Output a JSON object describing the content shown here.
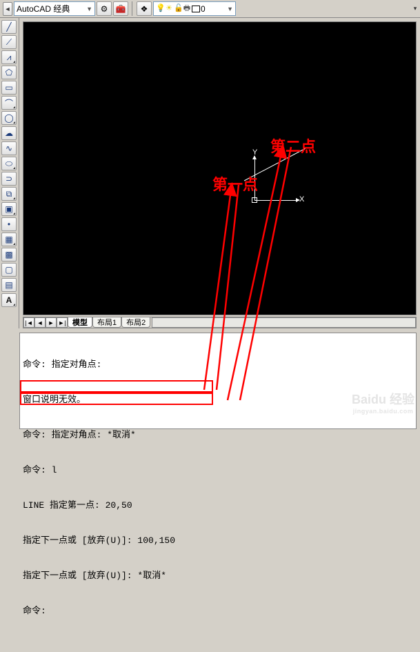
{
  "topbar": {
    "workspace_selected": "AutoCAD 经典",
    "layer_current": "0"
  },
  "axes": {
    "x_label": "X",
    "y_label": "Y"
  },
  "tabs": {
    "model": "模型",
    "layout1": "布局1",
    "layout2": "布局2"
  },
  "annotations": {
    "point1": "第一点",
    "point2": "第二点"
  },
  "command": {
    "l1": "命令: 指定对角点:",
    "l2": "窗口说明无效。",
    "l3": "命令: 指定对角点: *取消*",
    "l4": "命令: l",
    "l5": "LINE 指定第一点: 20,50",
    "l6": "指定下一点或 [放弃(U)]: 100,150",
    "l7": "指定下一点或 [放弃(U)]: *取消*",
    "l8": "命令:"
  },
  "watermark": {
    "brand": "Baidu 经验",
    "url": "jingyan.baidu.com"
  }
}
